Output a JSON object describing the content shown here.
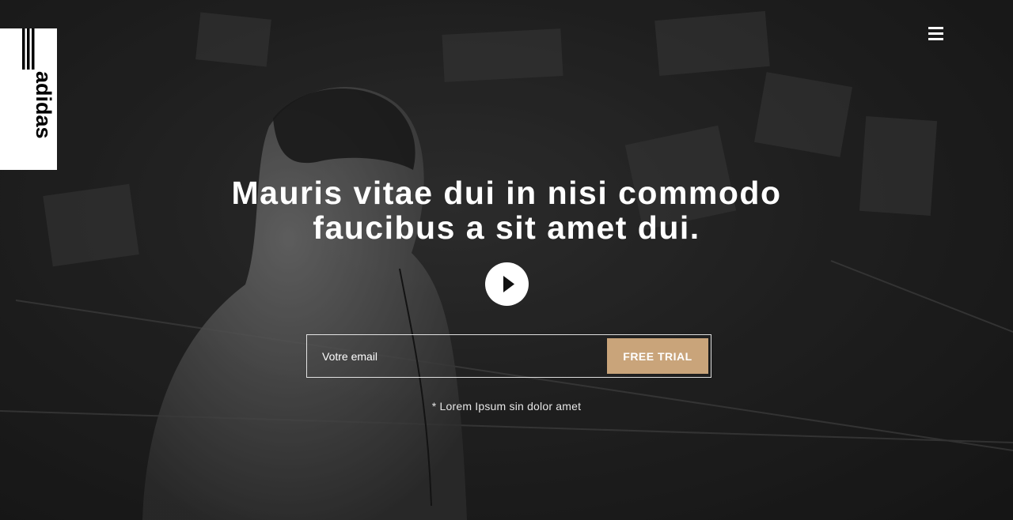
{
  "brand": {
    "logo_text": "adidas"
  },
  "nav": {
    "menu_icon": "hamburger-menu-icon"
  },
  "hero": {
    "headline_line1": "Mauris vitae dui in nisi commodo",
    "headline_line2": "faucibus a sit amet dui.",
    "play_icon": "play-icon"
  },
  "form": {
    "email_placeholder": "Votre email",
    "email_value": "",
    "submit_label": "FREE TRIAL"
  },
  "disclaimer": "* Lorem Ipsum sin dolor amet",
  "colors": {
    "accent": "#c9a47a",
    "overlay": "#1c1c1c",
    "text": "#ffffff"
  }
}
